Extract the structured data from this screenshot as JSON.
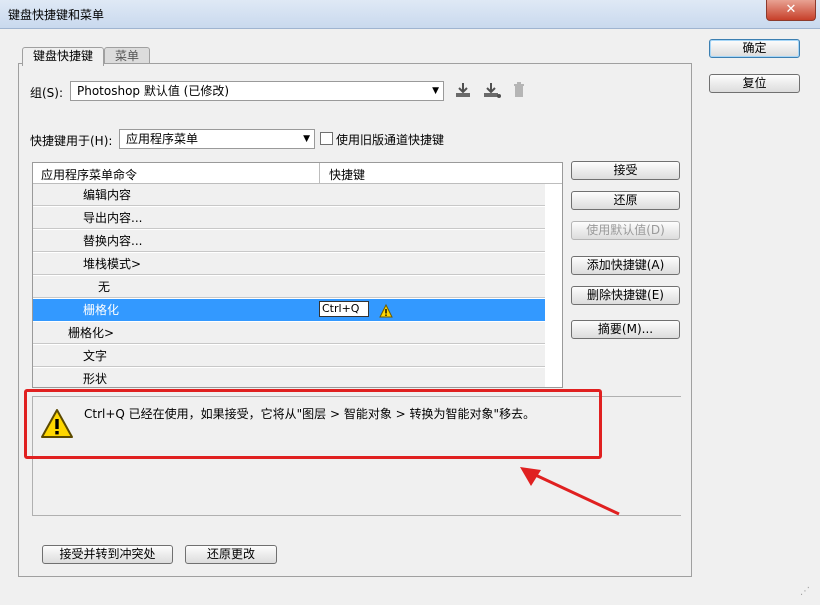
{
  "window": {
    "title": "键盘快捷键和菜单",
    "close_glyph": "✕"
  },
  "tabs": [
    {
      "label": "键盘快捷键"
    },
    {
      "label": "菜单"
    }
  ],
  "group": {
    "label": "组(S):",
    "value": "Photoshop 默认值 (已修改)"
  },
  "shortcuts_for": {
    "label": "快捷键用于(H):",
    "value": "应用程序菜单"
  },
  "legacy_channel": {
    "label": "使用旧版通道快捷键",
    "checked": false
  },
  "table": {
    "columns": [
      "应用程序菜单命令",
      "快捷键"
    ],
    "rows": [
      {
        "label": "编辑内容"
      },
      {
        "label": "导出内容..."
      },
      {
        "label": "替换内容..."
      },
      {
        "label": "堆栈模式>"
      },
      {
        "label": "无"
      },
      {
        "label": "栅格化",
        "shortcut": "Ctrl+Q",
        "selected": true
      },
      {
        "label": "栅格化>"
      },
      {
        "label": "文字"
      },
      {
        "label": "形状"
      }
    ]
  },
  "side_buttons": {
    "accept": "接受",
    "undo": "还原",
    "use_default": "使用默认值(D)",
    "add_shortcut": "添加快捷键(A)",
    "delete_shortcut": "删除快捷键(E)",
    "summary": "摘要(M)..."
  },
  "dialog_buttons": {
    "ok": "确定",
    "reset": "复位"
  },
  "message": "Ctrl+Q 已经在使用，如果接受，它将从\"图层 > 智能对象 > 转换为智能对象\"移去。",
  "bottom_buttons": {
    "accept_goto": "接受并转到冲突处",
    "revert": "还原更改"
  },
  "colors": {
    "highlight": "#3399ff",
    "annotation": "#e02020"
  }
}
